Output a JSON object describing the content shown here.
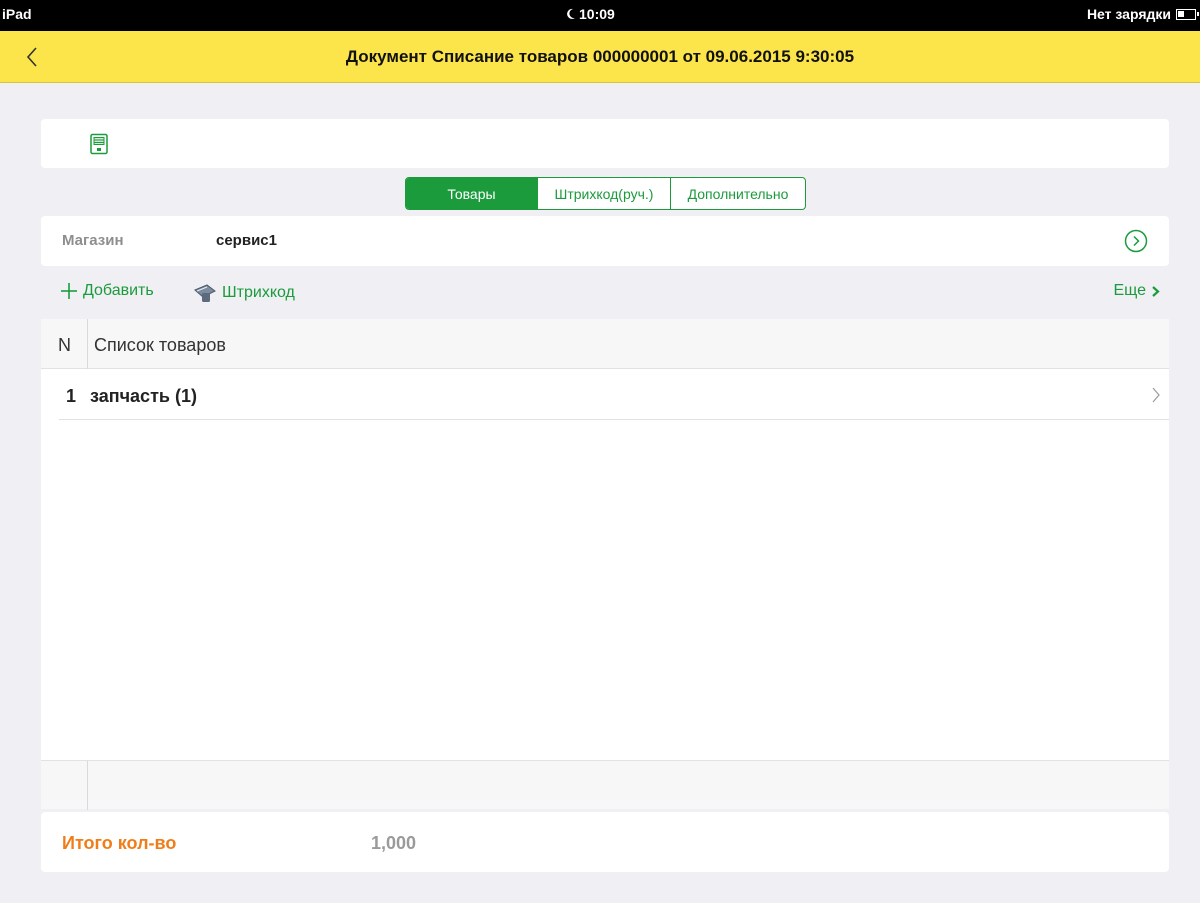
{
  "statusbar": {
    "device": "iPad",
    "time": "10:09",
    "charge": "Нет зарядки"
  },
  "navbar": {
    "title": "Документ Списание товаров 000000001 от 09.06.2015 9:30:05"
  },
  "tabs": [
    {
      "label": "Товары",
      "active": true
    },
    {
      "label": "Штрихкод(руч.)",
      "active": false
    },
    {
      "label": "Дополнительно",
      "active": false
    }
  ],
  "store": {
    "label": "Магазин",
    "value": "сервис1"
  },
  "actions": {
    "add": "Добавить",
    "barcode": "Штрихкод",
    "more": "Еще"
  },
  "table": {
    "headers": {
      "n": "N",
      "name": "Список товаров"
    },
    "rows": [
      {
        "n": "1",
        "name": "запчасть (1)"
      }
    ]
  },
  "total": {
    "label": "Итого кол-во",
    "value": "1,000"
  },
  "colors": {
    "accent": "#1b9b3c",
    "navbar": "#fbe54b",
    "total_label": "#ef7d1a"
  },
  "icons": [
    "moon-icon",
    "battery-icon",
    "back-chevron-icon",
    "save-icon",
    "circle-arrow-icon",
    "plus-icon",
    "scanner-icon",
    "chevron-right-icon"
  ]
}
